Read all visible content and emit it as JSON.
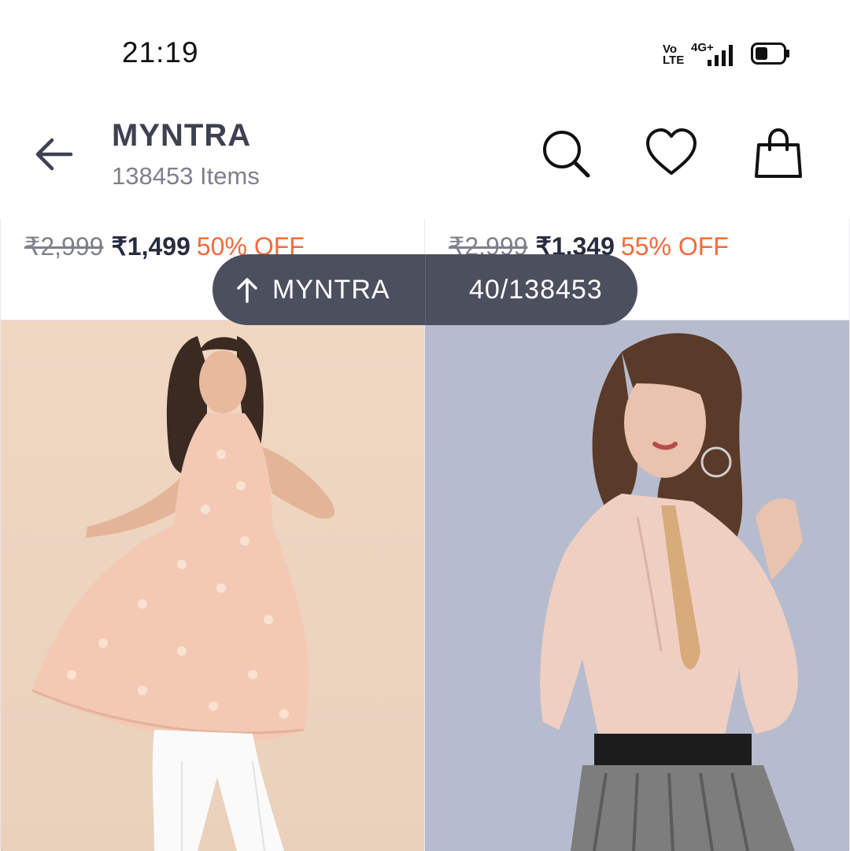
{
  "status_bar": {
    "time": "21:19",
    "volte": "Vo\nLTE",
    "network": "4G+",
    "icons": [
      "volte-icon",
      "signal-icon",
      "battery-icon"
    ]
  },
  "header": {
    "title": "MYNTRA",
    "item_count": "138453 Items",
    "icons": [
      "back-arrow-icon",
      "search-icon",
      "wishlist-heart-icon",
      "bag-icon"
    ]
  },
  "products": [
    {
      "mrp": "₹2,999",
      "price": "₹1,499",
      "discount": "50% OFF"
    },
    {
      "mrp": "₹2,999",
      "price": "₹1,349",
      "discount": "55% OFF"
    }
  ],
  "scroll_pill": {
    "brand": "MYNTRA",
    "position": "40/138453"
  },
  "colors": {
    "title": "#3e4152",
    "secondary_text": "#7e818c",
    "discount": "#f26a3b",
    "pill_bg": "#4c4f5e"
  }
}
